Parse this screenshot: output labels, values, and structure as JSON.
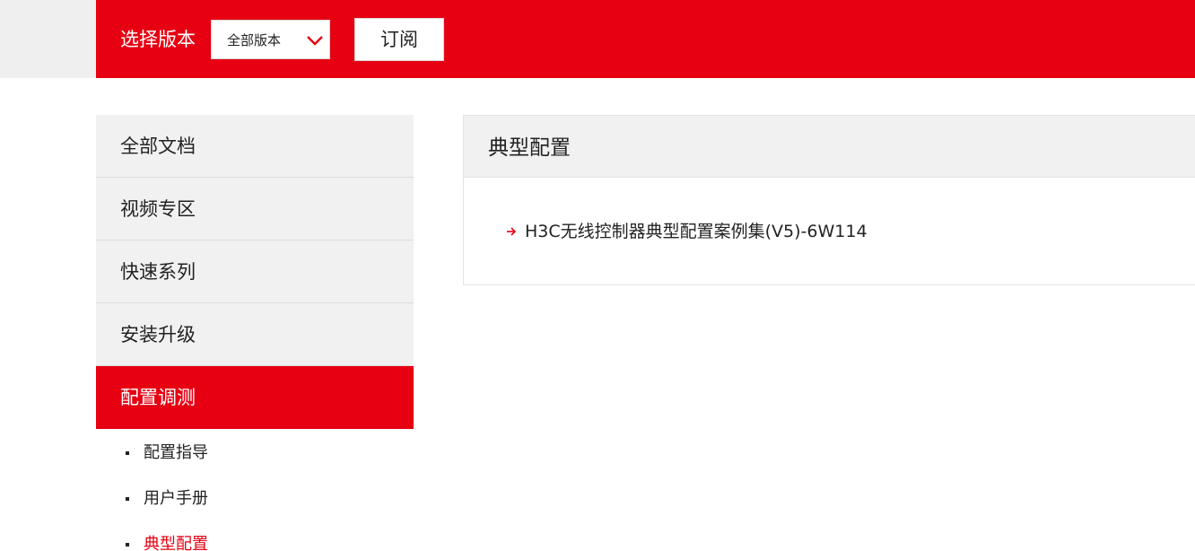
{
  "header": {
    "version_label": "选择版本",
    "version_select": {
      "selected": "全部版本"
    },
    "subscribe_label": "订阅"
  },
  "sidebar": {
    "items": [
      {
        "label": "全部文档"
      },
      {
        "label": "视频专区"
      },
      {
        "label": "快速系列"
      },
      {
        "label": "安装升级"
      },
      {
        "label": "配置调测"
      }
    ],
    "active_index": 4,
    "sub_items": [
      {
        "label": "配置指导"
      },
      {
        "label": "用户手册"
      },
      {
        "label": "典型配置"
      }
    ]
  },
  "main": {
    "title": "典型配置",
    "documents": [
      {
        "title": "H3C无线控制器典型配置案例集(V5)-6W114"
      }
    ]
  },
  "icons": {
    "dropdown": "chevron-down-icon",
    "doc_link": "arrow-right-icon"
  },
  "colors": {
    "brand_red": "#e60012",
    "panel_gray": "#f1f1f1",
    "text": "#222222"
  }
}
